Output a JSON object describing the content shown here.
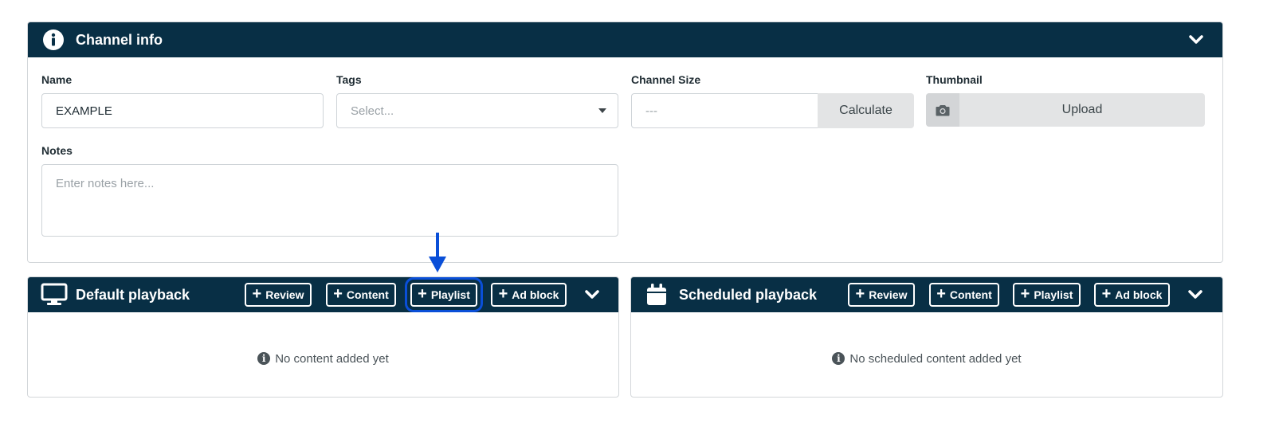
{
  "channel_info": {
    "title": "Channel info",
    "name": {
      "label": "Name",
      "value": "EXAMPLE"
    },
    "tags": {
      "label": "Tags",
      "placeholder": "Select..."
    },
    "channel_size": {
      "label": "Channel Size",
      "value": "---",
      "calculate_label": "Calculate"
    },
    "thumbnail": {
      "label": "Thumbnail",
      "upload_label": "Upload"
    },
    "notes": {
      "label": "Notes",
      "placeholder": "Enter notes here..."
    }
  },
  "default_playback": {
    "title": "Default playback",
    "buttons": [
      "Review",
      "Content",
      "Playlist",
      "Ad block"
    ],
    "empty_message": "No content added yet"
  },
  "scheduled_playback": {
    "title": "Scheduled playback",
    "buttons": [
      "Review",
      "Content",
      "Playlist",
      "Ad block"
    ],
    "empty_message": "No scheduled content added yet"
  },
  "colors": {
    "header_bg": "#082f45",
    "highlight": "#0a4fd8",
    "button_grey": "#e3e4e5"
  },
  "icons": {
    "channel_info": "info-circle-icon",
    "default_playback": "monitor-icon",
    "scheduled_playback": "calendar-icon",
    "thumbnail": "camera-icon",
    "collapse": "chevron-down-icon"
  }
}
